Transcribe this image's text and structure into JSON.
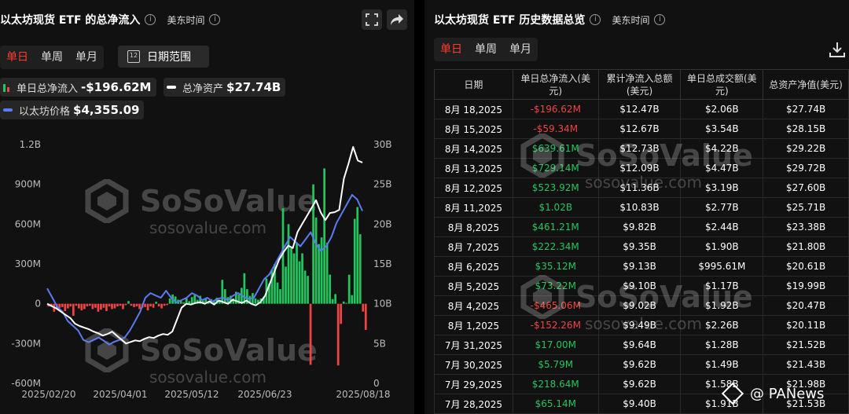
{
  "left": {
    "title": "以太坊现货 ETF 的总净流入",
    "timezone": "美东时间",
    "tabs": [
      "单日",
      "单周",
      "单月"
    ],
    "date_range_label": "日期范围",
    "legend": {
      "flow_label": "单日总净流入",
      "flow_value": "-$196.62M",
      "assets_label": "总净资产",
      "assets_value": "$27.74B",
      "price_label": "以太坊价格",
      "price_value": "$4,355.09"
    },
    "icons": {
      "fullscreen": "fullscreen-icon",
      "share": "share-icon",
      "info": "info-icon",
      "calendar": "calendar-icon"
    }
  },
  "right": {
    "title": "以太坊现货 ETF 历史数据总览",
    "timezone": "美东时间",
    "tabs": [
      "单日",
      "单周",
      "单月"
    ],
    "columns": [
      "日期",
      "单日总净流入(美元)",
      "累计净流入总额(美元)",
      "单日总成交额(美元)",
      "总资产净值(美元)"
    ],
    "rows": [
      [
        "8月 18,2025",
        "-$196.62M",
        "$12.47B",
        "$2.06B",
        "$27.74B"
      ],
      [
        "8月 15,2025",
        "-$59.34M",
        "$12.67B",
        "$3.54B",
        "$28.15B"
      ],
      [
        "8月 14,2025",
        "$639.61M",
        "$12.73B",
        "$4.22B",
        "$29.22B"
      ],
      [
        "8月 13,2025",
        "$729.14M",
        "$12.09B",
        "$4.47B",
        "$29.72B"
      ],
      [
        "8月 12,2025",
        "$523.92M",
        "$11.36B",
        "$3.19B",
        "$27.60B"
      ],
      [
        "8月 11,2025",
        "$1.02B",
        "$10.83B",
        "$2.77B",
        "$25.71B"
      ],
      [
        "8月 8,2025",
        "$461.21M",
        "$9.82B",
        "$2.44B",
        "$23.38B"
      ],
      [
        "8月 7,2025",
        "$222.34M",
        "$9.35B",
        "$1.90B",
        "$21.80B"
      ],
      [
        "8月 6,2025",
        "$35.12M",
        "$9.13B",
        "$995.61M",
        "$20.61B"
      ],
      [
        "8月 5,2025",
        "$73.22M",
        "$9.10B",
        "$1.17B",
        "$19.99B"
      ],
      [
        "8月 4,2025",
        "-$465.06M",
        "$9.02B",
        "$1.92B",
        "$20.47B"
      ],
      [
        "8月 1,2025",
        "-$152.26M",
        "$9.49B",
        "$2.26B",
        "$20.11B"
      ],
      [
        "7月 31,2025",
        "$17.00M",
        "$9.64B",
        "$1.28B",
        "$21.52B"
      ],
      [
        "7月 30,2025",
        "$5.79M",
        "$9.62B",
        "$1.49B",
        "$21.43B"
      ],
      [
        "7月 29,2025",
        "$218.64M",
        "$9.62B",
        "$1.58B",
        "$21.98B"
      ],
      [
        "7月 28,2025",
        "$65.14M",
        "$9.40B",
        "$1.91B",
        "$21.53B"
      ]
    ],
    "icons": {
      "download": "download-icon",
      "info": "info-icon"
    }
  },
  "watermark": {
    "brand": "SoSoValue",
    "url": "sosovalue.com"
  },
  "badge": {
    "text": "@ PANews"
  },
  "chart_data": {
    "type": "bar",
    "title": "",
    "left_axis": {
      "ticks": [
        "1.2B",
        "900M",
        "600M",
        "300M",
        "0",
        "-300M",
        "-600M"
      ],
      "ylim": [
        -600,
        1200
      ],
      "unit": "M USD"
    },
    "right_axis": {
      "ticks": [
        "30B",
        "25B",
        "20B",
        "15B",
        "10B",
        "5B",
        "0"
      ],
      "ylim": [
        0,
        30
      ],
      "unit": "B USD"
    },
    "x_ticks": [
      "2025/02/20",
      "2025/04/01",
      "2025/05/12",
      "2025/06/23",
      "2025/08/18"
    ],
    "series": [
      {
        "name": "单日总净流入",
        "type": "bar",
        "values": [
          -20,
          -15,
          -60,
          -40,
          -30,
          -25,
          -55,
          -35,
          -20,
          -90,
          -15,
          -35,
          -50,
          -40,
          -20,
          -15,
          -40,
          -30,
          -60,
          -45,
          -30,
          -55,
          -20,
          -40,
          -35,
          -20,
          -15,
          -40,
          -10,
          20,
          -15,
          -25,
          -20,
          -40,
          -30,
          -25,
          -50,
          -20,
          -30,
          15,
          -20,
          -35,
          -15,
          -10,
          40,
          70,
          55,
          30,
          25,
          10,
          40,
          20,
          50,
          65,
          30,
          60,
          25,
          40,
          15,
          35,
          20,
          45,
          30,
          180,
          110,
          50,
          60,
          40,
          90,
          70,
          120,
          230,
          110,
          60,
          80,
          40,
          30,
          40,
          50,
          190,
          150,
          260,
          300,
          160,
          110,
          720,
          280,
          600,
          420,
          380,
          460,
          320,
          380,
          250,
          210,
          -460,
          900,
          650,
          450,
          500,
          1020,
          460,
          220,
          35,
          73,
          -465,
          -152,
          17,
          6,
          219,
          65,
          640,
          729,
          524,
          -59,
          -197
        ]
      },
      {
        "name": "总净资产",
        "type": "line",
        "color": "#ffffff",
        "values": [
          10.0,
          9.7,
          9.4,
          9.0,
          8.6,
          8.2,
          7.5,
          7.2,
          7.0,
          6.8,
          6.5,
          6.3,
          6.0,
          6.2,
          6.5,
          6.0,
          5.5,
          5.0,
          5.2,
          5.4,
          5.3,
          5.6,
          5.8,
          5.7,
          6.0,
          6.2,
          6.1,
          6.5,
          8.0,
          9.5,
          10.0,
          9.9,
          10.1,
          10.2,
          10.0,
          10.3,
          9.9,
          10.4,
          10.2,
          10.0,
          10.5,
          10.3,
          10.1,
          10.4,
          10.0,
          9.8,
          10.2,
          11.0,
          12.5,
          14.0,
          15.5,
          16.5,
          17.3,
          17.0,
          19.0,
          20.0,
          21.0,
          22.0,
          23.0,
          21.5,
          20.5,
          21.4,
          21.5,
          21.8,
          25.7,
          27.6,
          29.7,
          28.0,
          27.74
        ]
      },
      {
        "name": "以太坊价格",
        "type": "line",
        "color": "#5b7cf0",
        "values": [
          2700,
          2500,
          2300,
          2200,
          2000,
          1900,
          1800,
          1600,
          1550,
          1600,
          1650,
          1580,
          1500,
          1560,
          1600,
          1650,
          1800,
          2000,
          2200,
          2500,
          2600,
          2550,
          2500,
          2650,
          2500,
          2400,
          2450,
          2500,
          2600,
          2550,
          2450,
          2500,
          2420,
          2480,
          2500,
          2450,
          2550,
          2600,
          2520,
          2480,
          2500,
          2700,
          2900,
          3000,
          3200,
          3400,
          3600,
          3800,
          3700,
          3600,
          3750,
          3900,
          3650,
          3500,
          3600,
          3800,
          4100,
          4300,
          4500,
          4700,
          4600,
          4355
        ]
      }
    ],
    "legend_position": "top-left",
    "grid": false
  }
}
